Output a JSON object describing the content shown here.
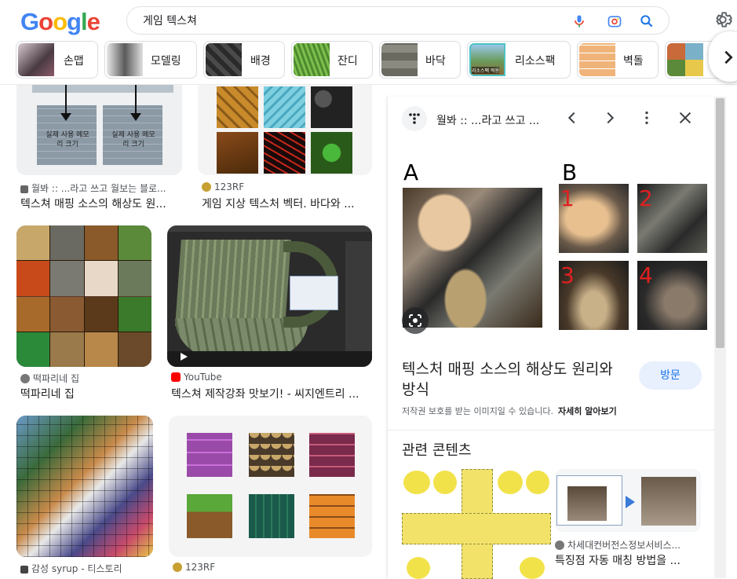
{
  "header": {
    "logo": "Google",
    "search_value": "게임 텍스쳐",
    "icons": [
      "mic-icon",
      "lens-icon",
      "search-icon",
      "gear-icon"
    ]
  },
  "chips": [
    {
      "label": "손맵",
      "thumb": "#5a4a52"
    },
    {
      "label": "모델링",
      "thumb": "#6b6b6b"
    },
    {
      "label": "배경",
      "thumb": "#3c3c3c"
    },
    {
      "label": "잔디",
      "thumb": "#5e9a3a"
    },
    {
      "label": "바닥",
      "thumb": "#7a7a72"
    },
    {
      "label": "리소스팩",
      "thumb": "#6a9a5a",
      "thumb_text": "리소스팩 적용"
    },
    {
      "label": "벽돌",
      "thumb": "#e9a86a"
    },
    {
      "label": "",
      "thumb": "#7ab0c8"
    }
  ],
  "results": [
    {
      "source": "월봐 :: ...라고 쓰고 월보는 블로...",
      "title": "텍스쳐 매핑 소스의 해상도 원...",
      "img_text": [
        "실제 사용 메모리 크기",
        "실제 사용 메모리 크기"
      ]
    },
    {
      "source": "123RF",
      "title": "게임 지상 텍스처 벡터. 바다와 ..."
    },
    {
      "source": "떡파리네 집",
      "title": "떡파리네 집"
    },
    {
      "source": "YouTube",
      "title": "텍스쳐 제작강좌 맛보기! - 씨지엔트리 ..."
    },
    {
      "source": "감성 syrup - 티스토리",
      "title": ""
    },
    {
      "source": "123RF",
      "title": ""
    }
  ],
  "panel": {
    "source": "월봐 :: ...라고 쓰고 ...",
    "title": "텍스처 매핑 소스의 해상도 원리와 방식",
    "visit": "방문",
    "copyright": "저작권 보호를 받는 이미지일 수 있습니다.",
    "learn_more": "자세히 알아보기",
    "image_labels": {
      "a": "A",
      "b": "B",
      "n1": "1",
      "n2": "2",
      "n3": "3",
      "n4": "4"
    },
    "related_title": "관련 콘텐츠",
    "related": [
      {
        "source": "",
        "title": ""
      },
      {
        "source": "차세대컨버전스정보서비스...",
        "title": "특징점 자동 매칭 방법을 ..."
      }
    ]
  }
}
